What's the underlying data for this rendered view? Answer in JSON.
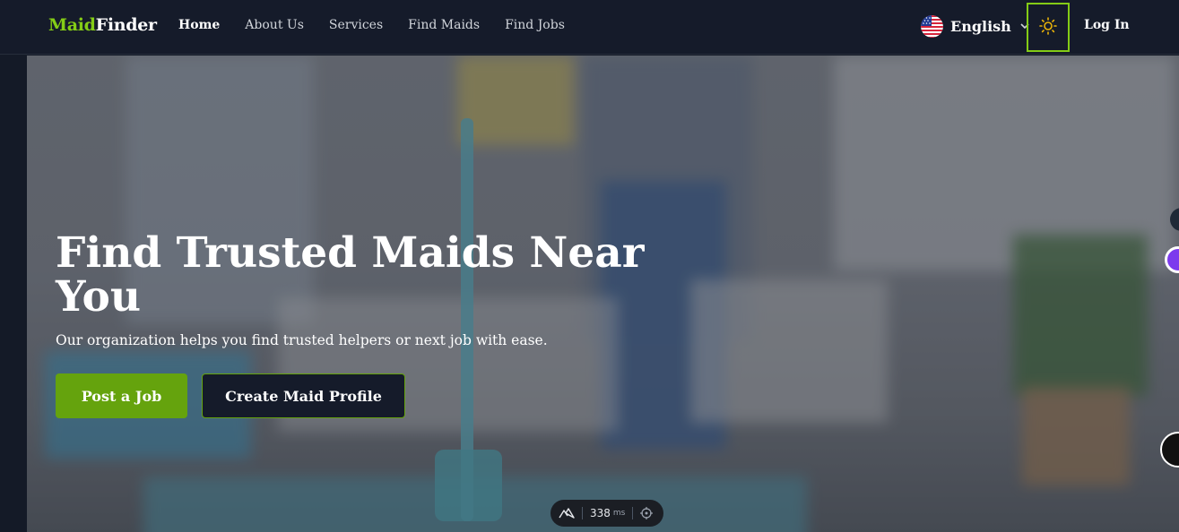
{
  "header": {
    "logo": {
      "part1": "Maid",
      "part2": "Finder"
    },
    "nav": [
      {
        "label": "Home",
        "active": true
      },
      {
        "label": "About Us",
        "active": false
      },
      {
        "label": "Services",
        "active": false
      },
      {
        "label": "Find Maids",
        "active": false
      },
      {
        "label": "Find Jobs",
        "active": false
      }
    ],
    "language": {
      "label": "English",
      "flag": "us-flag-icon"
    },
    "theme_toggle": {
      "icon": "sun-icon"
    },
    "login_label": "Log In"
  },
  "hero": {
    "title": "Find Trusted Maids Near You",
    "subtitle": "Our organization helps you find trusted helpers or next job with ease.",
    "primary_button": "Post a Job",
    "secondary_button": "Create Maid Profile"
  },
  "devtools": {
    "time_value": "338",
    "time_unit": "ms"
  },
  "colors": {
    "accent": "#84cc16",
    "button_green": "#65a30d",
    "header_bg": "#151b2a"
  }
}
